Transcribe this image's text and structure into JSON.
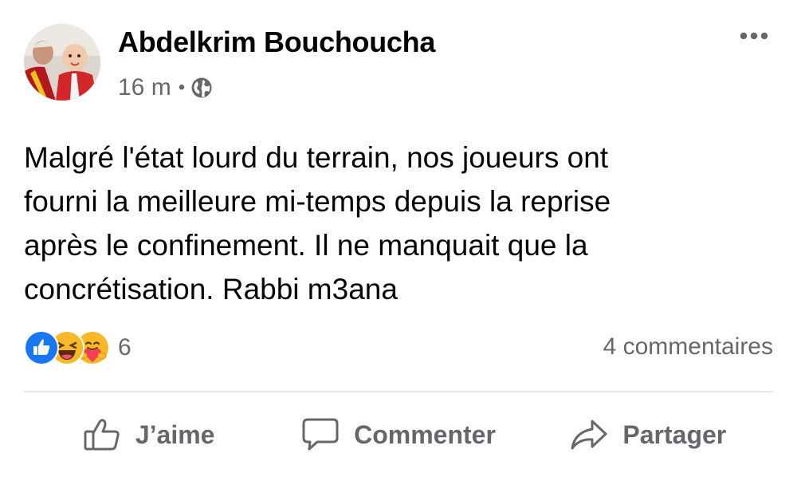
{
  "post": {
    "author": "Abdelkrim Bouchoucha",
    "time": "16 m",
    "separator": "•",
    "privacy_icon": "globe-icon",
    "text": "Malgré l'état lourd du terrain, nos joueurs ont\nfourni la meilleure mi-temps depuis la reprise\naprès le confinement. Il ne manquait que la\nconcrétisation. Rabbi m3ana",
    "more_icon": "more-options-icon"
  },
  "reactions": {
    "icons": [
      "like-icon",
      "haha-icon",
      "care-icon"
    ],
    "count": "6"
  },
  "comments": {
    "label": "4 commentaires"
  },
  "actions": {
    "like": "J’aime",
    "comment": "Commenter",
    "share": "Partager"
  },
  "colors": {
    "like_blue": "#1877f2",
    "emoji_yellow": "#f7b928",
    "secondary_text": "#65676b",
    "primary_text": "#050505",
    "divider": "#e4e6eb"
  }
}
